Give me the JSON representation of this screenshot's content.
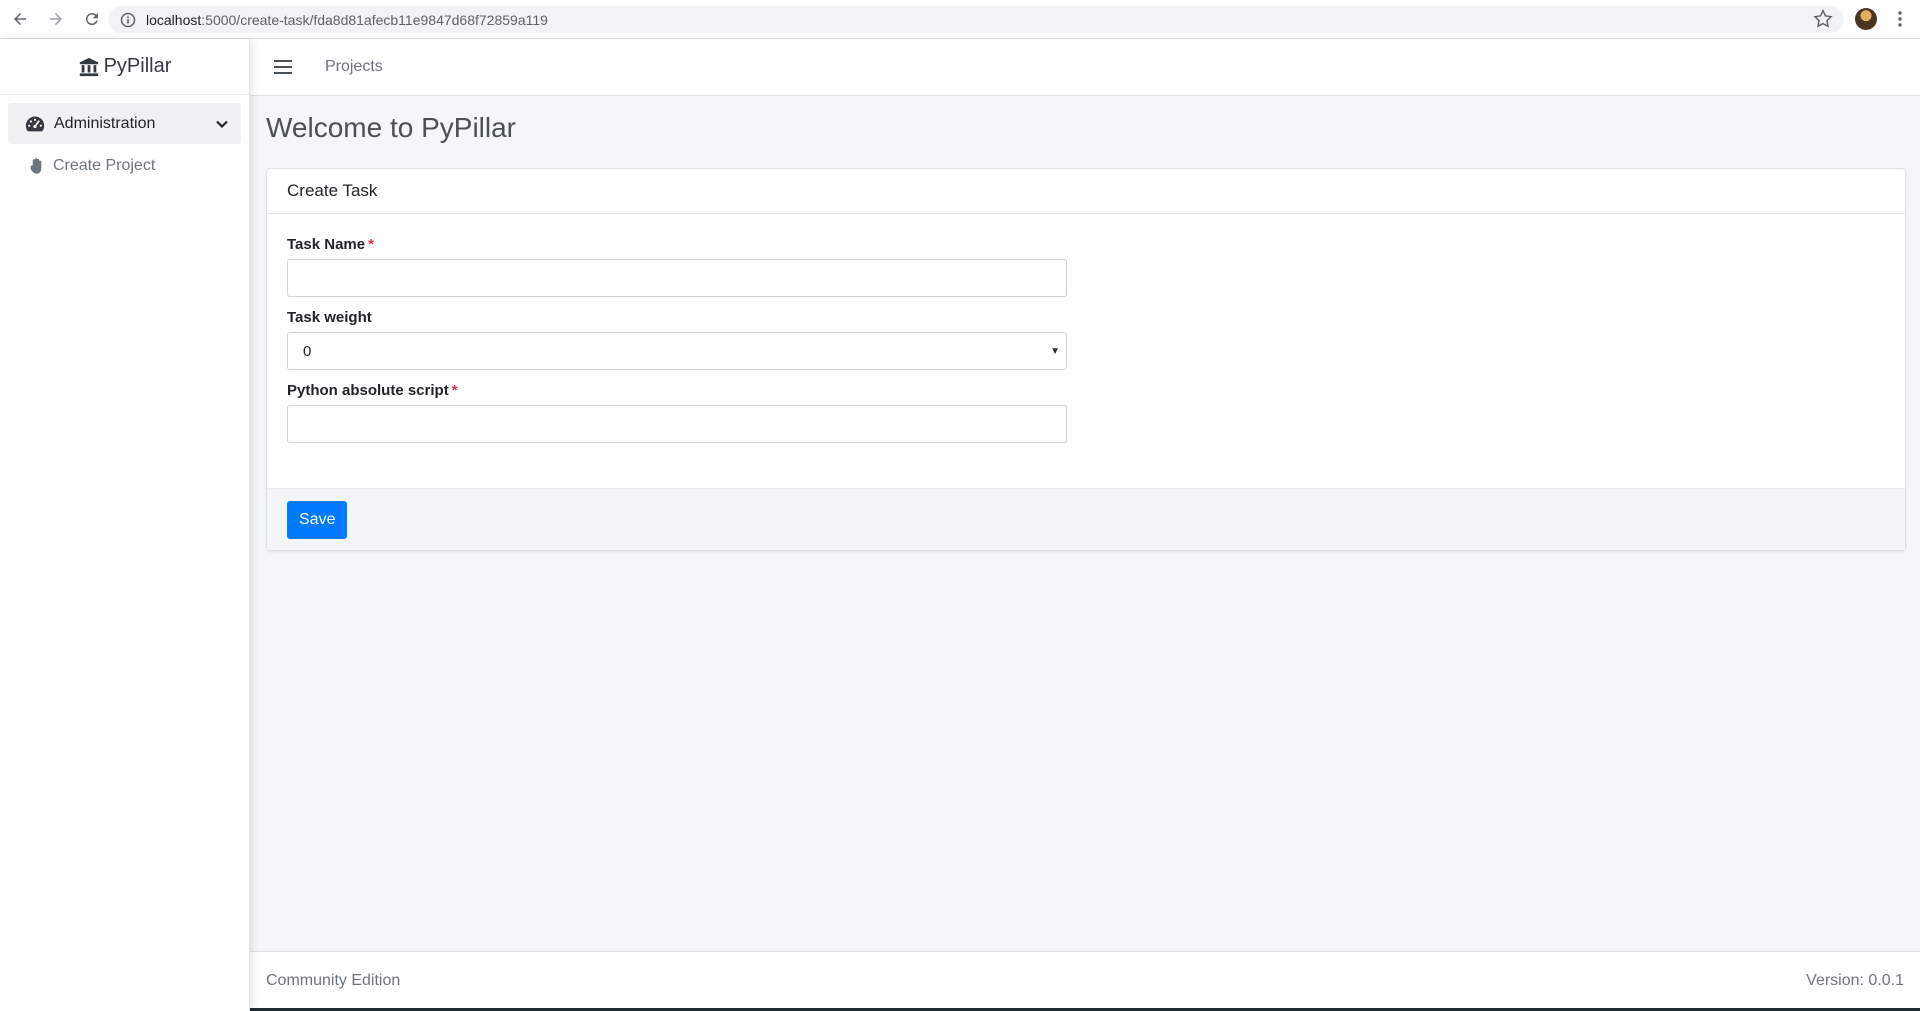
{
  "browser": {
    "url_host": "localhost",
    "url_path": ":5000/create-task/fda8d81afecb11e9847d68f72859a119"
  },
  "sidebar": {
    "brand": "PyPillar",
    "admin_label": "Administration",
    "items": [
      {
        "label": "Create Project"
      }
    ]
  },
  "topbar": {
    "link": "Projects"
  },
  "main": {
    "title": "Welcome to PyPillar",
    "card": {
      "header": "Create Task",
      "fields": [
        {
          "label": "Task Name",
          "required": true,
          "value": ""
        },
        {
          "label": "Task weight",
          "required": false,
          "value": "0"
        },
        {
          "label": "Python absolute script",
          "required": true,
          "value": ""
        }
      ],
      "save_label": "Save"
    }
  },
  "footer": {
    "left": "Community Edition",
    "right": "Version: 0.0.1"
  },
  "colors": {
    "primary": "#007bff",
    "required": "#dc3545",
    "content_bg": "#f4f6f9"
  }
}
